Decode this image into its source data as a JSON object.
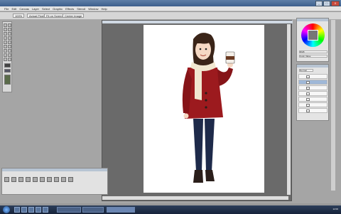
{
  "window": {
    "title": "",
    "buttons": [
      "_",
      "□",
      "X"
    ]
  },
  "menu": [
    "File",
    "Edit",
    "Canvas",
    "Layer",
    "Select",
    "Graphic",
    "Effects",
    "Stencil",
    "Window",
    "Help"
  ],
  "options": {
    "zoom": "100%",
    "b1": "Actual Pixels",
    "b2": "Fit on Screen",
    "b3": "Center Image"
  },
  "right_panels": {
    "color_fields": [
      "RGB",
      "Color Value"
    ],
    "layers_mode": "Normal"
  },
  "taskbar": {
    "items": [
      "",
      "",
      ""
    ],
    "clock": "12:00"
  },
  "colors": {
    "coat": "#9c1a1e",
    "scarf": "#f1e7d0",
    "pants": "#1e2a4a",
    "hair": "#3a2418",
    "boots": "#2a1e1a",
    "skin": "#f6d9c4"
  }
}
